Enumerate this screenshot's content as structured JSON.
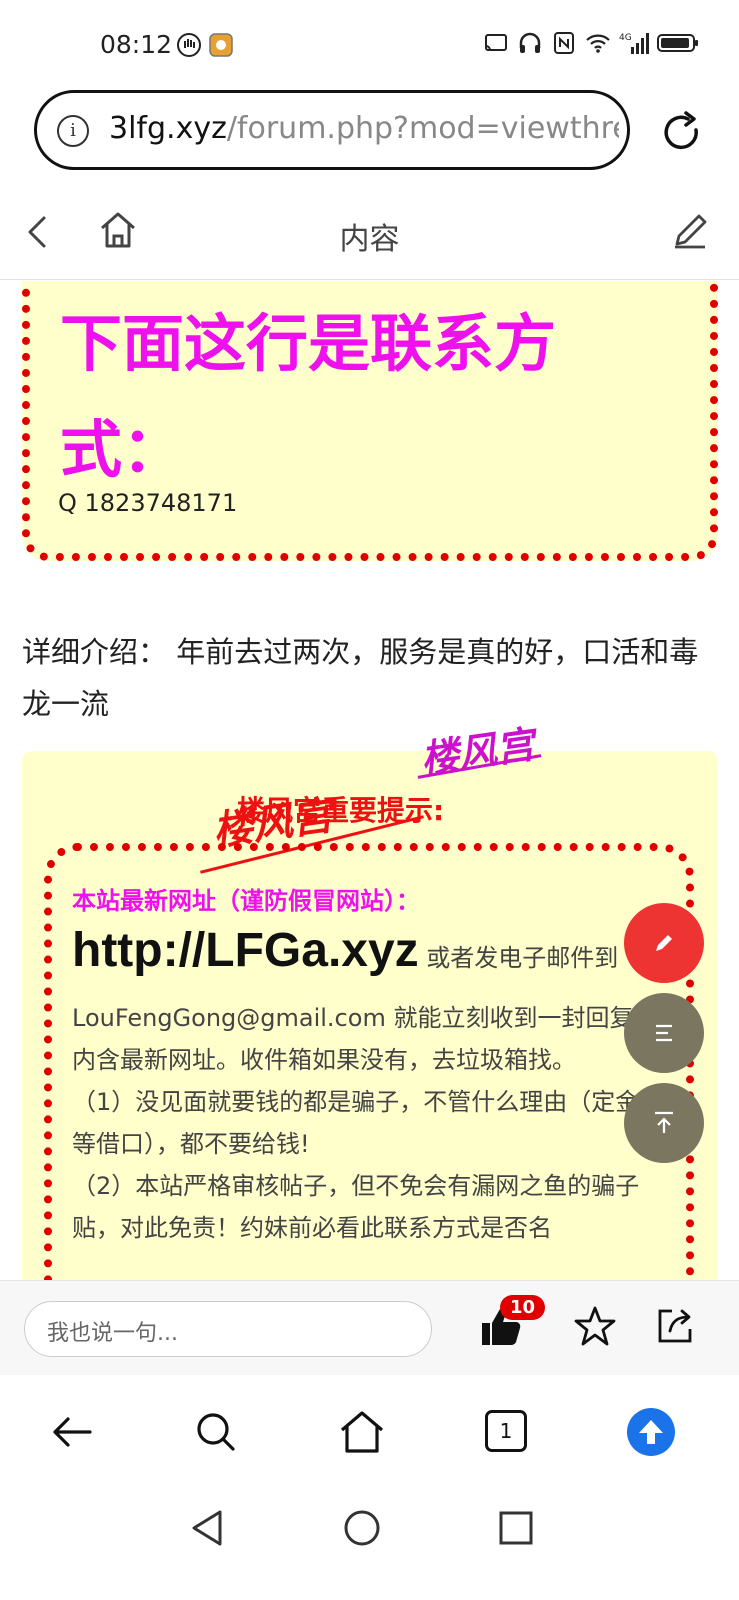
{
  "status_bar": {
    "time": "08:12",
    "left_icons": [
      "hand-icon",
      "app-icon"
    ],
    "right_icons": [
      "cast-icon",
      "headphones-icon",
      "nfc-icon",
      "wifi-icon",
      "signal-4g-icon",
      "battery-icon"
    ]
  },
  "url_bar": {
    "domain": "3lfg.xyz",
    "path": "/forum.php?mod=viewthre"
  },
  "nav": {
    "title": "内容"
  },
  "contact_box": {
    "heading": "下面这行是联系方式：",
    "qq": "Q 1823748171"
  },
  "intro": {
    "text": "详细介绍： 年前去过两次，服务是真的好，口活和毒龙一流"
  },
  "notice": {
    "watermark": "楼风宫",
    "heading": "楼风宫重要提示:",
    "subheading": "本站最新网址（谨防假冒网站）：",
    "url": "http://LFGa.xyz",
    "or_text": " 或者发电子邮件到",
    "body_lines": [
      "LouFengGong@gmail.com 就能立刻收到一封回复，内含最新网址。收件箱如果没有，去垃圾箱找。",
      "（1）没见面就要钱的都是骗子，不管什么理由（定金，等借口），都不要给钱!",
      "（2）本站严格审核帖子，但不免会有漏网之鱼的骗子贴，对此免责！约妹前必看此联系方式是否名"
    ]
  },
  "fabs": {
    "edit_icon": "pencil-icon",
    "menu_icon": "menu-icon",
    "top_icon": "back-to-top-icon"
  },
  "comment_bar": {
    "placeholder": "我也说一句...",
    "like_count": "10"
  },
  "browser_toolbar": {
    "tab_count": "1"
  },
  "colors": {
    "magenta": "#ee11ee",
    "red": "#e00000",
    "box_yellow": "#ffffcc",
    "accent_blue": "#1a73e8"
  }
}
